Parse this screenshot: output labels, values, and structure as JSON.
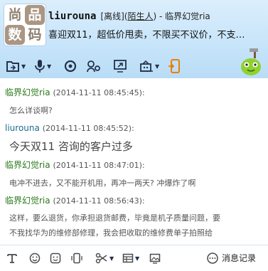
{
  "contact": {
    "nickname": "liurouna",
    "status": "[离线](",
    "stranger_link": "陌生人",
    "status_tail": ") - 临界幻觉ria",
    "signature": "喜迎双11，超低价甩卖，不限买不议价，不支…",
    "avatar_chars": [
      "尚",
      "品",
      "数",
      "码"
    ]
  },
  "toolbar": {
    "icons": [
      "file-transfer-icon",
      "voice-call-icon",
      "video-call-icon",
      "remote-assist-icon",
      "screen-share-icon",
      "app-store-icon",
      "phone-transfer-icon"
    ]
  },
  "messages": [
    {
      "sender": "临界幻觉ria",
      "time": "(2014-11-11 08:45:45):",
      "text": "怎么详谈啊?",
      "big": false,
      "me": false
    },
    {
      "sender": "liurouna",
      "time": "(2014-11-11 08:45:52):",
      "text": "今天双11  咨询的客户过多",
      "big": true,
      "me": true
    },
    {
      "sender": "临界幻觉ria",
      "time": "(2014-11-11 08:47:01):",
      "text": "电冲不进去，又不能开机用，再冲一两天? 冲爆炸了啊",
      "big": false,
      "me": false
    },
    {
      "sender": "临界幻觉ria",
      "time": "(2014-11-11 08:56:43):",
      "text": "这样，要么退货，你承担退货邮费，毕竟是机子质量问题，要",
      "text2": "不我找华为的维修部修理，我会把收取的维修费单子拍照给",
      "big": false,
      "me": false
    }
  ],
  "bottom": {
    "history_label": "消息记录",
    "icons": [
      "font-icon",
      "emoji-icon",
      "magic-emoji-icon",
      "shake-icon",
      "screenshot-icon",
      "layout-icon",
      "image-icon"
    ]
  }
}
